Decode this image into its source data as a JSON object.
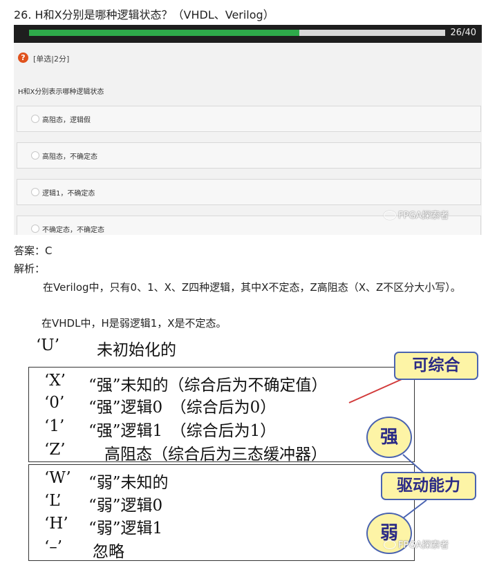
{
  "question_title": "26. H和X分别是哪种逻辑状态？（VHDL、Verilog）",
  "quiz": {
    "progress_text": "26/40",
    "progress_fraction": 0.65,
    "type_icon": "?",
    "type_label": "[单选|2分]",
    "question": "H和X分别表示哪种逻辑状态",
    "options": [
      "高阻态，逻辑假",
      "高阻态，不确定态",
      "逻辑1，不确定态",
      "不确定态，不确定态"
    ],
    "colors": {
      "progress": "#2eaa4a",
      "icon": "#e0521d",
      "bar": "#1e1e1e"
    }
  },
  "watermark": "FPGA探索者",
  "answer": "答案：C",
  "analysis_label": "解析：",
  "analysis": [
    "在Verilog中，只有0、1、X、Z四种逻辑，其中X不定态，Z高阻态（X、Z不区分大小写）。",
    "在VHDL中，H是弱逻辑1，X是不定态。"
  ],
  "slide": {
    "undefined_row": {
      "sym": "‘U’",
      "desc": "未初始化的"
    },
    "strong_rows": [
      {
        "sym": "‘X’",
        "desc": "“强”未知的（综合后为不确定值）"
      },
      {
        "sym": "‘0’",
        "desc": "“强”逻辑0　（综合后为0）"
      },
      {
        "sym": "‘1’",
        "desc": "“强”逻辑1　（综合后为1）"
      },
      {
        "sym": "‘Z’",
        "desc": "　高阻态（综合后为三态缓冲器）"
      }
    ],
    "weak_rows": [
      {
        "sym": "‘W’",
        "desc": "“弱”未知的"
      },
      {
        "sym": "‘L’",
        "desc": "“弱”逻辑0"
      },
      {
        "sym": "‘H’",
        "desc": "“弱”逻辑1"
      },
      {
        "sym": "‘–’",
        "desc": "忽略"
      }
    ],
    "callout_synth": "可综合",
    "bubble_strong": "强",
    "callout_drive": "驱动能力",
    "bubble_weak": "弱"
  }
}
